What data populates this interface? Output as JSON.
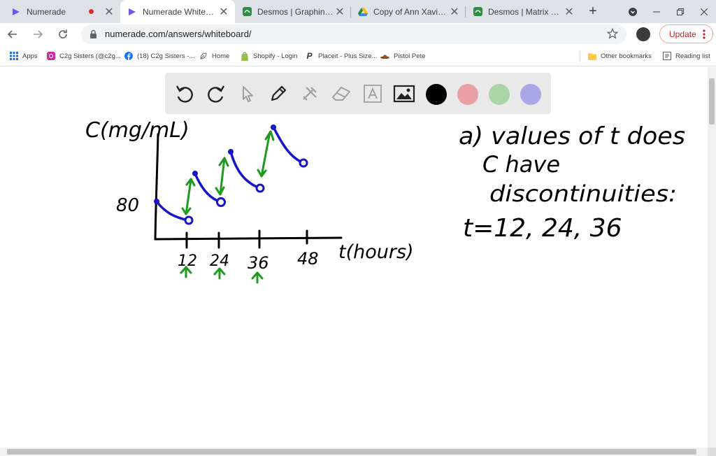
{
  "browser": {
    "tabs": [
      {
        "title": "Numerade",
        "icon": "numerade-icon",
        "recording": true,
        "active": false
      },
      {
        "title": "Numerade Whiteboard",
        "icon": "numerade-icon",
        "active": true
      },
      {
        "title": "Desmos | Graphing Calcula",
        "icon": "desmos-icon",
        "active": false
      },
      {
        "title": "Copy of Ann Xavier Ganter",
        "icon": "google-drive-icon",
        "active": false
      },
      {
        "title": "Desmos | Matrix Calculator",
        "icon": "desmos-icon",
        "active": false
      }
    ],
    "new_tab": "+",
    "url": "numerade.com/answers/whiteboard/",
    "update_label": "Update",
    "bookmarks": [
      {
        "label": "Apps",
        "icon": "apps-grid-icon"
      },
      {
        "label": "C2g Sisters (@c2g...",
        "icon": "instagram-icon"
      },
      {
        "label": "(18) C2g Sisters -...",
        "icon": "facebook-icon"
      },
      {
        "label": "Home",
        "icon": "home-leaf-icon"
      },
      {
        "label": "Shopify - Login",
        "icon": "shopify-icon"
      },
      {
        "label": "Placeit - Plus Size...",
        "icon": "placeit-icon"
      },
      {
        "label": "Pistol Pete",
        "icon": "cowboy-hat-icon"
      }
    ],
    "other_bookmarks": "Other bookmarks",
    "reading_list": "Reading list"
  },
  "whiteboard": {
    "tools": [
      "undo-icon",
      "redo-icon",
      "pointer-icon",
      "pen-icon",
      "tools-icon",
      "eraser-icon",
      "text-icon",
      "image-icon"
    ],
    "colors": [
      "#000000",
      "#e8a0a6",
      "#a9d5a9",
      "#a9a8e6"
    ],
    "handwriting": {
      "y_label": "C(mg/mL)",
      "y_tick": "80",
      "x_label": "t(hours)",
      "x_ticks": [
        "12",
        "24",
        "36",
        "48"
      ],
      "answer_line1": "a) values of t does",
      "answer_line2": "C have",
      "answer_line3": "discontinuities:",
      "answer_line4": "t=12, 24, 36"
    }
  }
}
